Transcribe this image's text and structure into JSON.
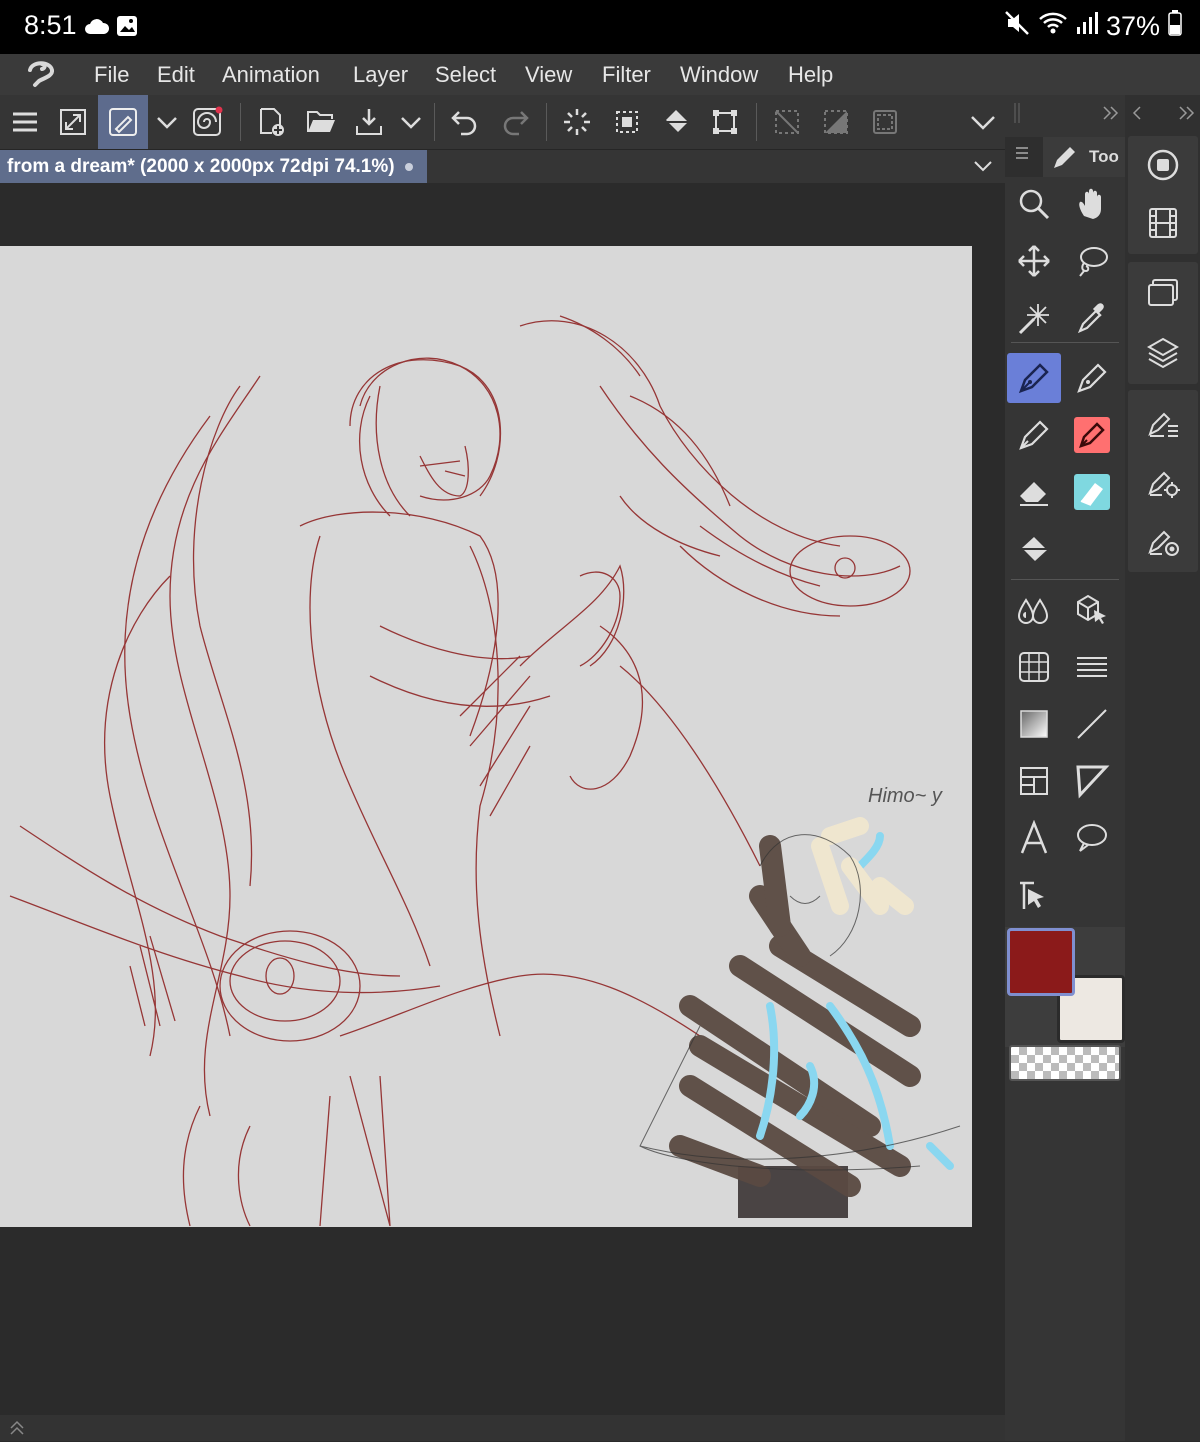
{
  "status": {
    "time": "8:51",
    "battery": "37%",
    "icons": [
      "cloud-icon",
      "gallery-icon",
      "mute-icon",
      "wifi-icon",
      "signal-icon",
      "battery-icon"
    ]
  },
  "menu": {
    "items": [
      "File",
      "Edit",
      "Animation",
      "Layer",
      "Select",
      "View",
      "Filter",
      "Window",
      "Help"
    ]
  },
  "document": {
    "title": "from a dream* (2000 x 2000px 72dpi 74.1%)"
  },
  "tool_panel": {
    "tab_label": "Too"
  },
  "canvas": {
    "signature": "Himo~ y"
  },
  "colors": {
    "main": "#8b1a1a",
    "sub": "#ede8e2",
    "canvas_bg": "#d8d8d8",
    "accent": "#6a7fd8"
  }
}
